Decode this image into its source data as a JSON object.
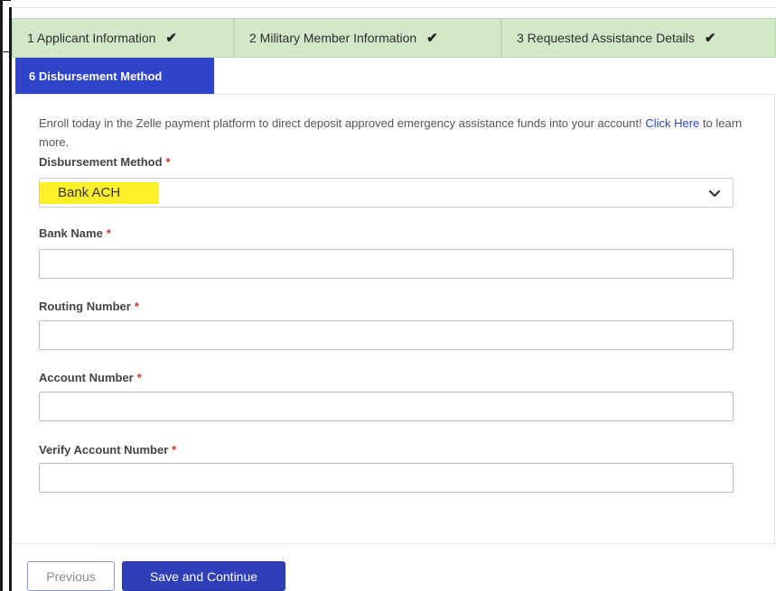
{
  "steps": [
    {
      "label": "1 Applicant Information",
      "status": "complete"
    },
    {
      "label": "2 Military Member Information",
      "status": "complete"
    },
    {
      "label": "3 Requested Assistance Details",
      "status": "complete"
    }
  ],
  "check_glyph": "✔",
  "active_step": {
    "label": "6 Disbursement Method"
  },
  "intro": {
    "text_before": "Enroll today in the Zelle payment platform to direct deposit approved emergency assistance funds into your account! ",
    "link_text": "Click Here",
    "text_after": " to learn more."
  },
  "required_marker": "*",
  "form": {
    "disbursement_method": {
      "label": "Disbursement Method",
      "value": "Bank ACH",
      "highlight_color": "#ffef2b"
    },
    "bank_name": {
      "label": "Bank Name",
      "value": ""
    },
    "routing_number": {
      "label": "Routing Number",
      "value": ""
    },
    "account_number": {
      "label": "Account Number",
      "value": ""
    },
    "verify_account_number": {
      "label": "Verify Account Number",
      "value": ""
    }
  },
  "buttons": {
    "previous": "Previous",
    "save_continue": "Save and Continue"
  },
  "colors": {
    "step_complete_bg": "#d2e8c9",
    "active_tab_bg": "#2e44c9",
    "primary_button": "#2e3fb8",
    "link": "#2e44c9",
    "required": "#c0392b"
  },
  "icons": {
    "step_check": "checkmark-icon",
    "select_toggle": "chevron-down-icon"
  }
}
